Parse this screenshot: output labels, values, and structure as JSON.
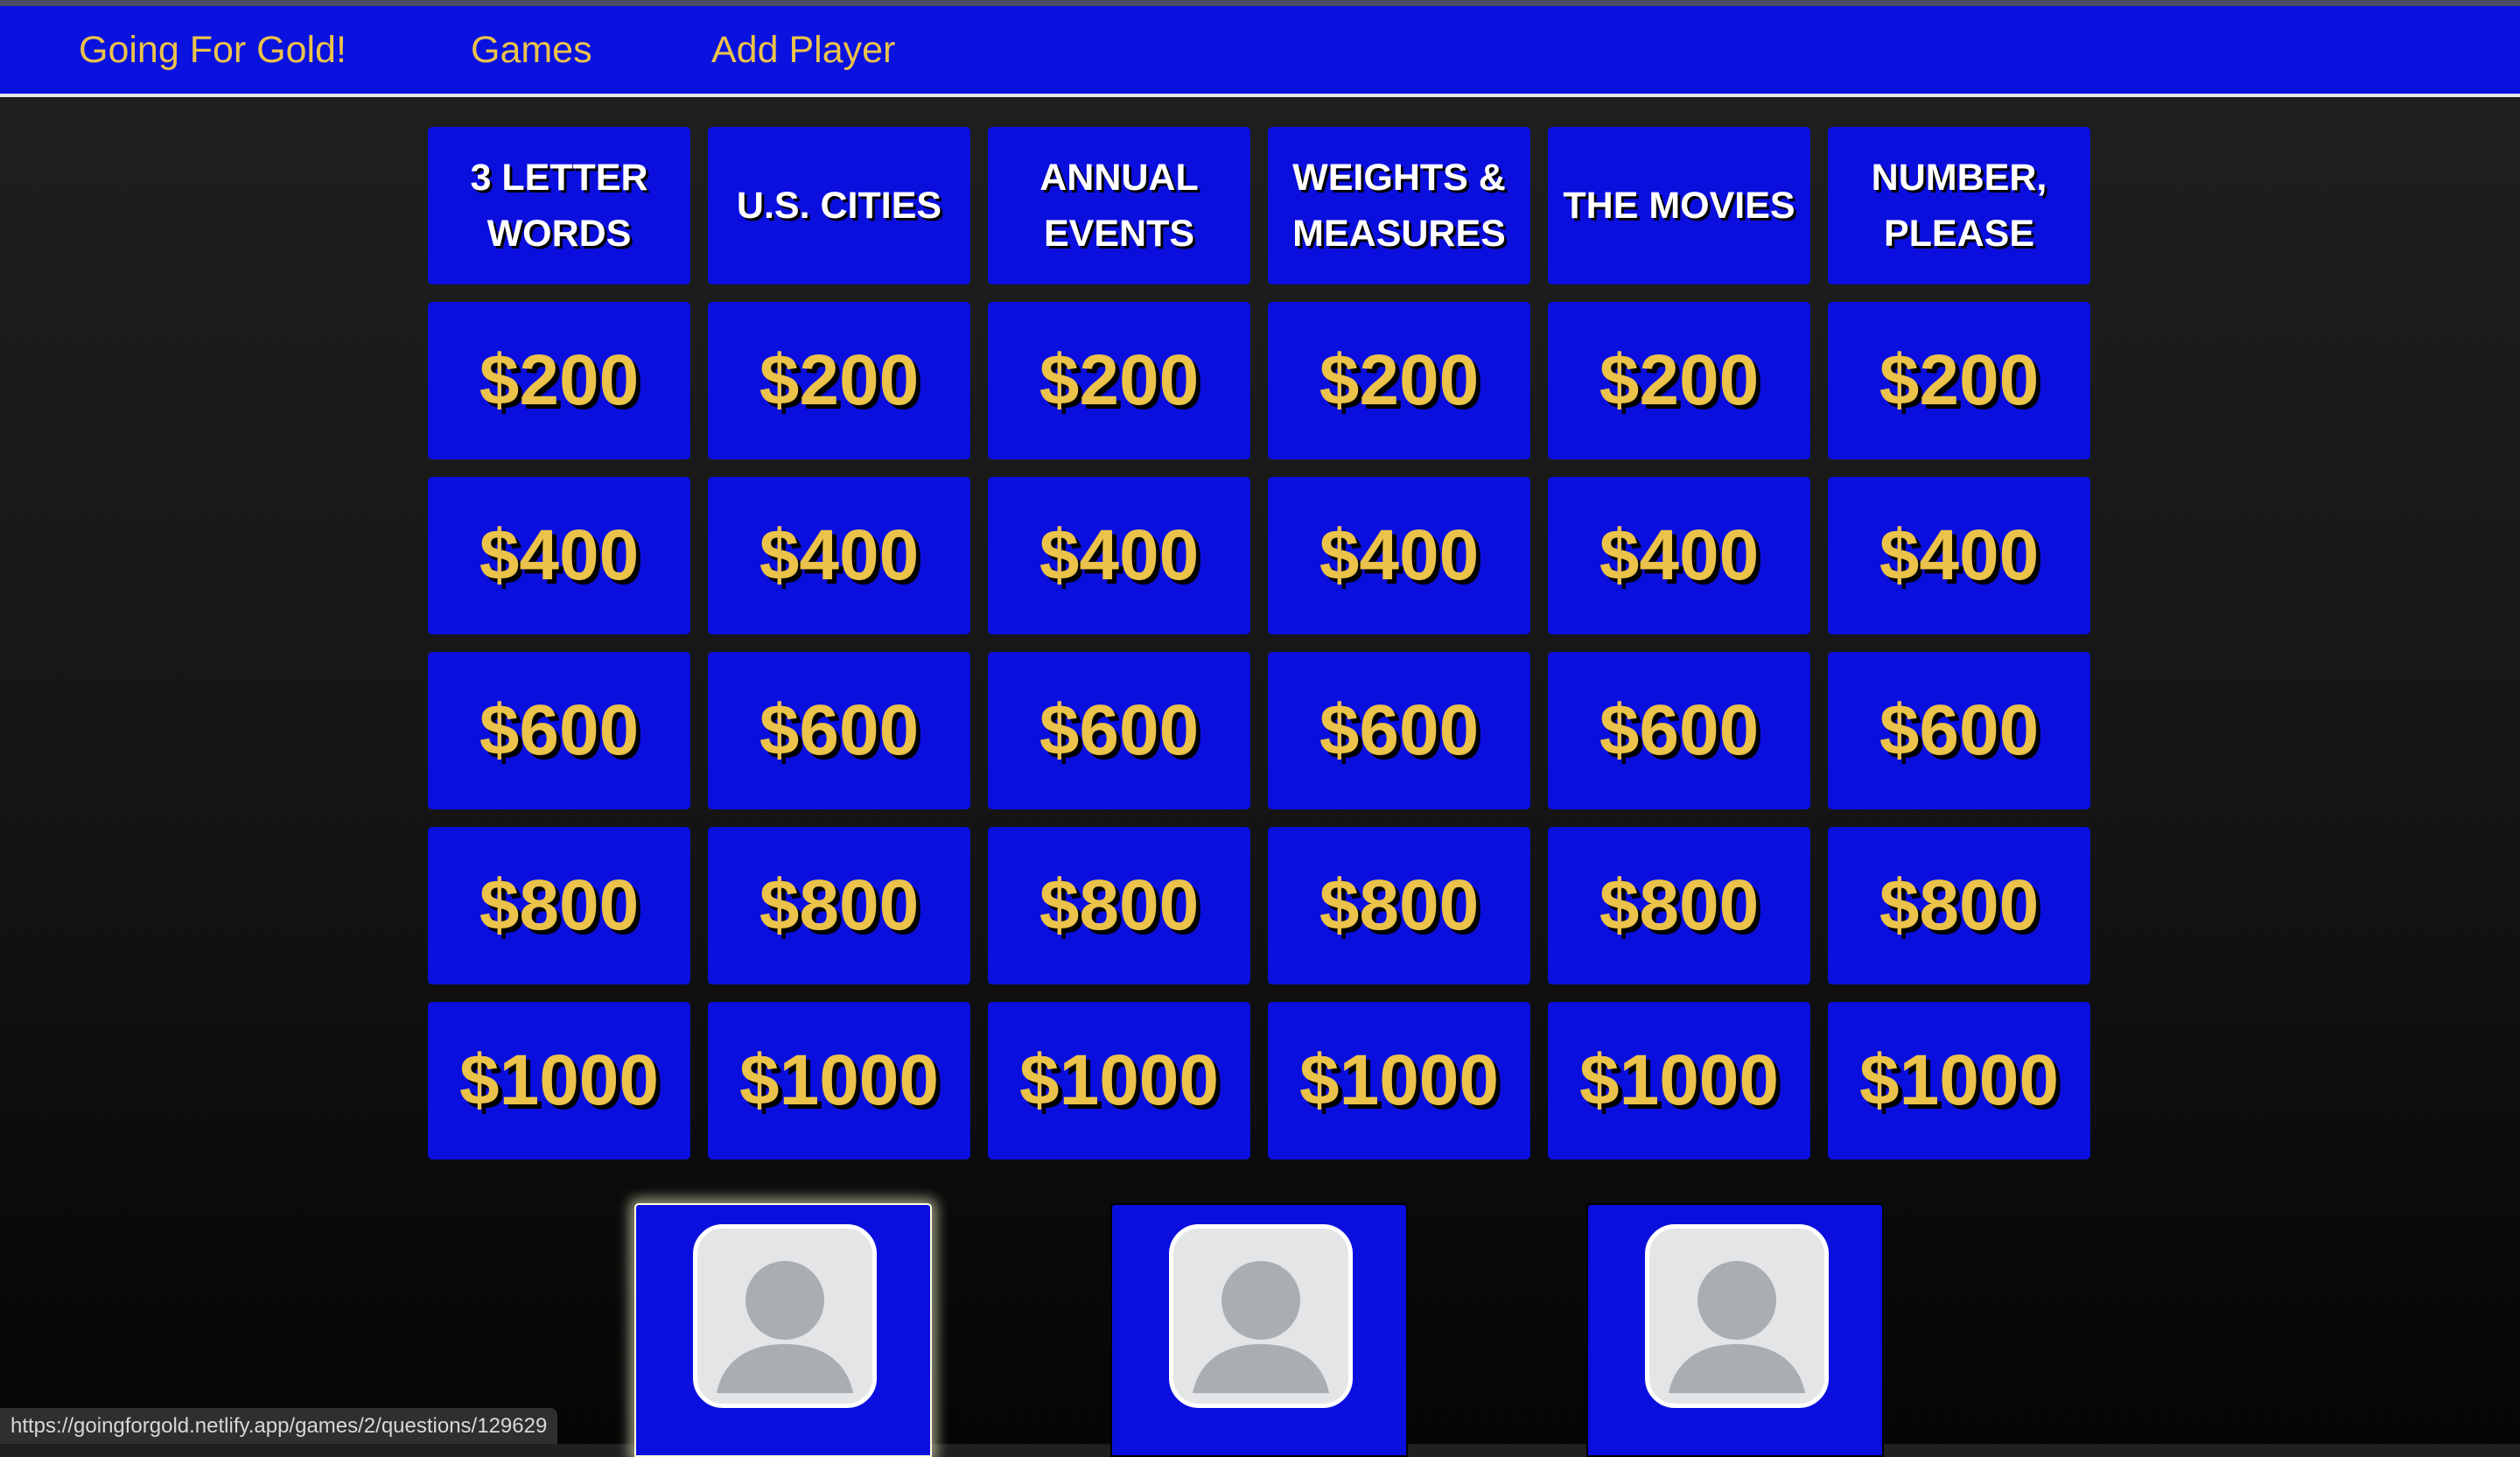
{
  "nav": {
    "brand": "Going For Gold!",
    "games": "Games",
    "add_player": "Add Player"
  },
  "board": {
    "categories": [
      "3 LETTER WORDS",
      "U.S. CITIES",
      "ANNUAL EVENTS",
      "WEIGHTS & MEASURES",
      "THE MOVIES",
      "NUMBER, PLEASE"
    ],
    "rows": [
      [
        "$200",
        "$200",
        "$200",
        "$200",
        "$200",
        "$200"
      ],
      [
        "$400",
        "$400",
        "$400",
        "$400",
        "$400",
        "$400"
      ],
      [
        "$600",
        "$600",
        "$600",
        "$600",
        "$600",
        "$600"
      ],
      [
        "$800",
        "$800",
        "$800",
        "$800",
        "$800",
        "$800"
      ],
      [
        "$1000",
        "$1000",
        "$1000",
        "$1000",
        "$1000",
        "$1000"
      ]
    ]
  },
  "players": [
    {
      "avatar_icon": "user-placeholder-icon",
      "highlighted": true
    },
    {
      "avatar_icon": "user-placeholder-icon",
      "highlighted": false
    },
    {
      "avatar_icon": "user-placeholder-icon",
      "highlighted": false
    }
  ],
  "status_bar": {
    "url": "https://goingforgold.netlify.app/games/2/questions/129629"
  },
  "colors": {
    "nav_bg": "#0a12e0",
    "tile_bg": "#0a0fde",
    "gold_text": "#ebc24a",
    "category_text": "#ffffff",
    "page_bg": "#1a1a1a"
  }
}
